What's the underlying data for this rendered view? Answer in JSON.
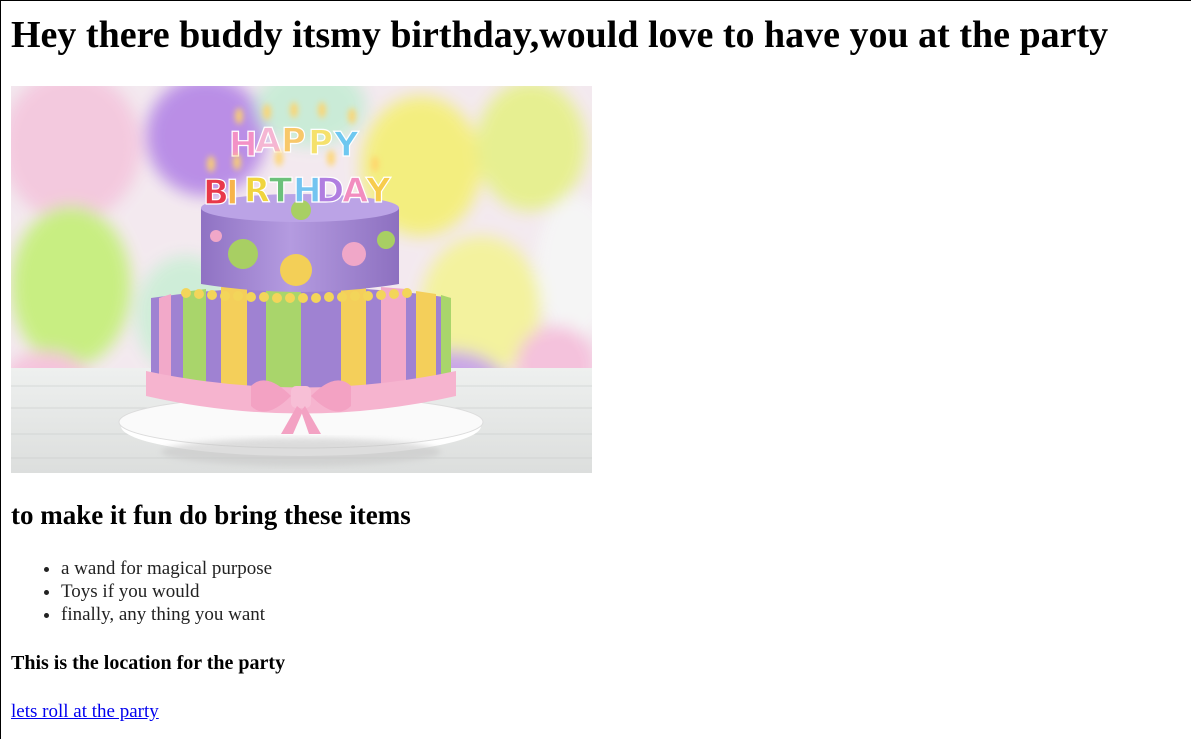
{
  "heading": "Hey there buddy itsmy birthday,would love to have you at the party",
  "image": {
    "cake_letters": [
      "H",
      "A",
      "P",
      "P",
      "Y",
      "B",
      "I",
      "R",
      "T",
      "H",
      "D",
      "A",
      "Y"
    ]
  },
  "subheading": "to make it fun do bring these items",
  "items": [
    "a wand for magical purpose",
    "Toys if you would",
    "finally, any thing you want"
  ],
  "location_heading": "This is the location for the party",
  "link_text": "lets roll at the party",
  "colors": {
    "link": "#0000ee",
    "cake_top": "#a98bd6",
    "cake_bottom": "#9d7fd0",
    "stripe_yellow": "#f4cf5a",
    "stripe_green": "#a9d56b",
    "stripe_pink": "#f2a9c9",
    "ribbon": "#f6b4cf"
  }
}
